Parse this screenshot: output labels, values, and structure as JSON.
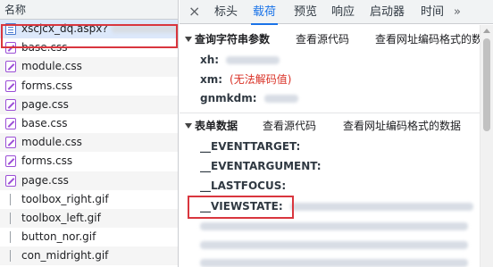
{
  "left_panel": {
    "header": "名称",
    "files": [
      {
        "name": "xscjcx_dq.aspx?",
        "icon": "document-icon",
        "type": "doc"
      },
      {
        "name": "base.css",
        "icon": "css-file-icon",
        "type": "css"
      },
      {
        "name": "module.css",
        "icon": "css-file-icon",
        "type": "css"
      },
      {
        "name": "forms.css",
        "icon": "css-file-icon",
        "type": "css"
      },
      {
        "name": "page.css",
        "icon": "css-file-icon",
        "type": "css"
      },
      {
        "name": "base.css",
        "icon": "css-file-icon",
        "type": "css"
      },
      {
        "name": "module.css",
        "icon": "css-file-icon",
        "type": "css"
      },
      {
        "name": "forms.css",
        "icon": "css-file-icon",
        "type": "css"
      },
      {
        "name": "page.css",
        "icon": "css-file-icon",
        "type": "css"
      },
      {
        "name": "toolbox_right.gif",
        "icon": "image-file-icon",
        "type": "gif"
      },
      {
        "name": "toolbox_left.gif",
        "icon": "image-file-icon",
        "type": "gif"
      },
      {
        "name": "button_nor.gif",
        "icon": "image-file-icon",
        "type": "gif"
      },
      {
        "name": "con_midright.gif",
        "icon": "image-file-icon",
        "type": "gif"
      }
    ]
  },
  "tabs": {
    "close": "×",
    "items": [
      "标头",
      "载荷",
      "预览",
      "响应",
      "启动器",
      "时间"
    ],
    "active": "载荷",
    "more": "»"
  },
  "query_section": {
    "title": "查询字符串参数",
    "view_source": "查看源代码",
    "view_url_encoded": "查看网址编码格式的数",
    "params": [
      {
        "key": "xh:",
        "value": ""
      },
      {
        "key": "xm:",
        "value": "(无法解码值)"
      },
      {
        "key": "gnmkdm:",
        "value": ""
      }
    ]
  },
  "form_section": {
    "title": "表单数据",
    "view_source": "查看源代码",
    "view_url_encoded": "查看网址编码格式的数据",
    "fields": [
      {
        "key": "__EVENTTARGET:"
      },
      {
        "key": "__EVENTARGUMENT:"
      },
      {
        "key": "__LASTFOCUS:"
      },
      {
        "key": "__VIEWSTATE:"
      }
    ]
  },
  "colors": {
    "accent": "#1a73e8",
    "highlight_box": "#d9363e",
    "error_text": "#d93025"
  }
}
